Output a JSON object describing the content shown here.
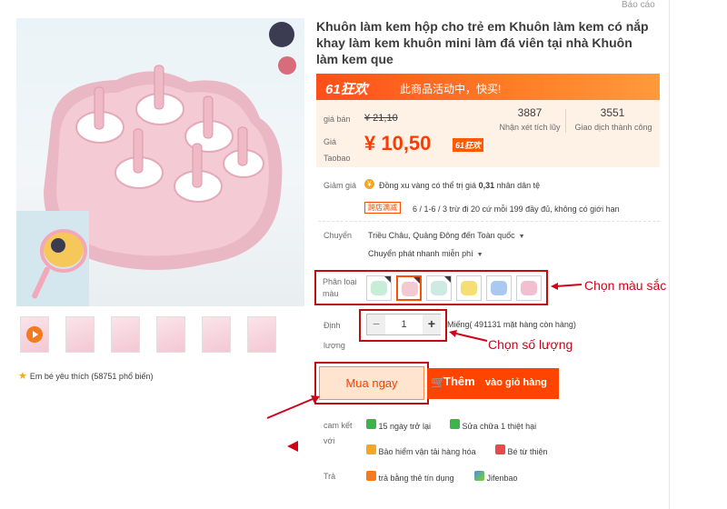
{
  "report_link": "Báo cáo",
  "gallery": {
    "favorite_text": "Em bé yêu thích (58751 phổ biến)"
  },
  "product": {
    "title": "Khuôn làm kem hộp cho trẻ em Khuôn làm kem có nắp khay làm kem khuôn mini làm đá viên tại nhà Khuôn làm kem que"
  },
  "promo": {
    "tag": "61狂欢",
    "message": "此商品活动中，快买!"
  },
  "price": {
    "price_label": "giá bán",
    "original_price": "¥ 21,10",
    "taobao_label_1": "Giá",
    "taobao_label_2": "Taobao",
    "current_price": "¥ 10,50",
    "sale_badge": "61狂欢",
    "reviews_count": "3887",
    "reviews_label": "Nhận xét tích lũy",
    "transactions_count": "3551",
    "transactions_label": "Giao dịch thành công"
  },
  "discount": {
    "label": "Giảm giá",
    "coin_text_1": "Đồng xu vàng có thể trị giá ",
    "coin_value": "0,31",
    "coin_text_2": " nhân dân tệ",
    "shop_tag": "跨店满减",
    "shop_text": "6 / 1-6 / 3 trừ đi 20 cứ mỗi 199 đầy đủ, không có giới hạn"
  },
  "shipping": {
    "label": "Chuyển",
    "route": "Triều Châu, Quảng Đông đến Toàn quốc",
    "method": "Chuyển phát nhanh miễn phí"
  },
  "colors": {
    "label_1": "Phân loại",
    "label_2": "màu",
    "options": [
      {
        "name": "Xanh lá",
        "color": "#c7ecd8"
      },
      {
        "name": "Hồng",
        "color": "#f3c9d2"
      },
      {
        "name": "Xanh nhạt",
        "color": "#cfe9e3"
      },
      {
        "name": "Vàng",
        "color": "#f6de74"
      },
      {
        "name": "Xanh dương",
        "color": "#a9c9f2"
      },
      {
        "name": "Hồng nhạt",
        "color": "#f2bfd0"
      }
    ],
    "annotation": "Chọn màu sắc"
  },
  "quantity": {
    "label_1": "Định",
    "label_2": "lượng",
    "minus": "−",
    "value": "1",
    "plus": "+",
    "stock_text": "Miếng( 491131 mặt hàng còn hàng)",
    "annotation": "Chọn số lượng"
  },
  "actions": {
    "buy_now": "Mua ngay",
    "cart_word_1": "Thêm",
    "cart_word_2": "vào giỏ hàng"
  },
  "guarantee": {
    "label_1": "cam kết",
    "label_2": "với",
    "items": [
      "15 ngày trở lại",
      "Sửa chữa 1 thiệt hại",
      "Bảo hiểm vận tải hàng hóa",
      "Bé từ thiện"
    ]
  },
  "payment": {
    "label": "Trả",
    "items": [
      "trả bằng thẻ tín dụng",
      "Jifenbao"
    ]
  },
  "colors_ui": {
    "accent": "#ff5000",
    "annotation_red": "#d0021b"
  }
}
